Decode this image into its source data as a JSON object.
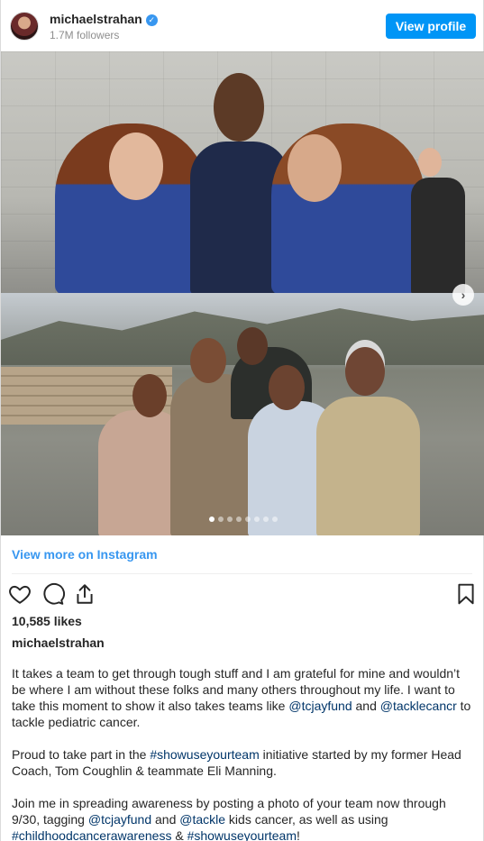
{
  "header": {
    "username": "michaelstrahan",
    "followers": "1.7M followers",
    "view_profile_label": "View profile"
  },
  "post": {
    "carousel_dots": 8,
    "carousel_active_dot": 1,
    "view_more_label": "View more on Instagram",
    "likes": "10,585 likes",
    "caption_username": "michaelstrahan",
    "caption": {
      "p1_a": "It takes a team to get through tough stuff and I am grateful for mine and wouldn’t be where I am without these folks and many others throughout my life. I want to take this moment to show it also takes teams like ",
      "p1_link1": "@tcjayfund",
      "p1_b": " and ",
      "p1_link2": "@tacklecancr",
      "p1_c": " to tackle pediatric cancer.",
      "p2_a": "Proud to take part in the ",
      "p2_link": "#showuseyourteam",
      "p2_b": " initiative started by my former Head Coach, Tom Coughlin & teammate Eli Manning.",
      "p3_a": "Join me in spreading awareness by posting a photo of your team now through 9/30, tagging ",
      "p3_link1": "@tcjayfund",
      "p3_b": " and ",
      "p3_link2": "@tackle",
      "p3_c": " kids cancer, as well as using ",
      "p3_link3": "#childhoodcancerawareness",
      "p3_d": " & ",
      "p3_link4": "#showuseyourteam",
      "p3_e": "!"
    }
  },
  "colors": {
    "accent": "#0095f6",
    "link": "#3897f0",
    "mention": "#003569"
  }
}
